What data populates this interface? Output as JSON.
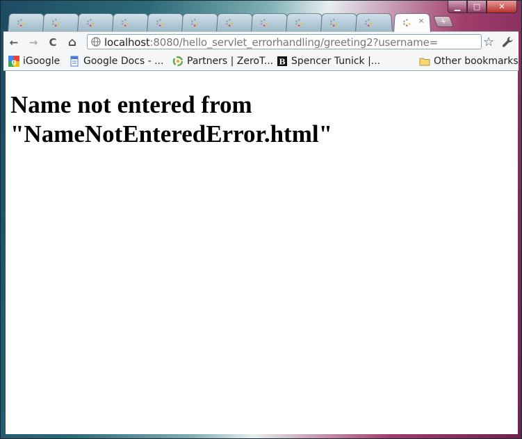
{
  "window": {
    "controls": {
      "minimize": "▁",
      "maximize": "□",
      "close": "✕"
    }
  },
  "tabs": {
    "count": 11,
    "active_index": 11,
    "active_close": "✕",
    "new_tab": "+"
  },
  "toolbar": {
    "back": "←",
    "forward": "→",
    "reload": "C",
    "home": "⌂",
    "star": "☆",
    "url_host": "localhost",
    "url_rest": ":8080/hello_servlet_errorhandling/greeting2?username="
  },
  "bookmarks": {
    "items": [
      {
        "label": "iGoogle",
        "icon": "igoogle-icon"
      },
      {
        "label": "Google Docs - ...",
        "icon": "google-docs-icon"
      },
      {
        "label": "Partners | ZeroT...",
        "icon": "zeroturnaround-icon"
      },
      {
        "label": "Spencer Tunick |...",
        "icon": "spencer-tunick-icon"
      }
    ],
    "other": "Other bookmarks"
  },
  "page": {
    "heading": "Name not entered from \"NameNotEnteredError.html\""
  }
}
